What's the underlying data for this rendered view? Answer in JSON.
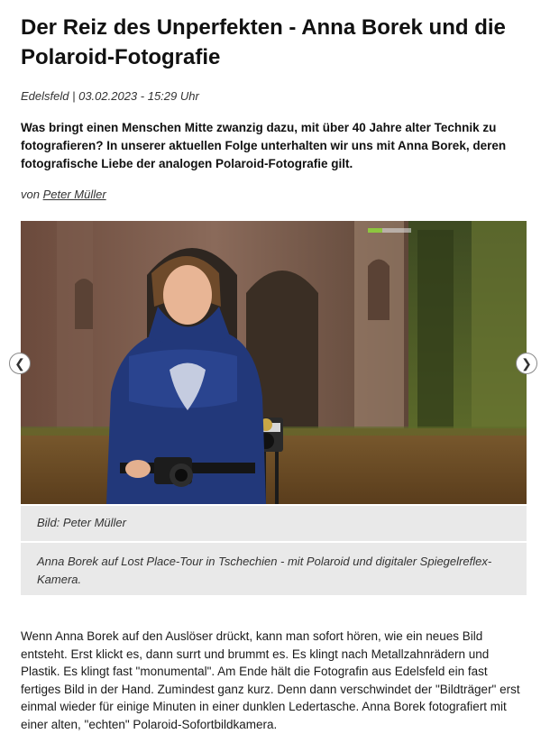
{
  "article": {
    "title": "Der Reiz des Unperfekten - Anna Borek und die Polaroid-Fotografie",
    "location": "Edelsfeld",
    "separator": " | ",
    "datetime": "03.02.2023 - 15:29 Uhr",
    "lead": "Was bringt einen Menschen Mitte zwanzig dazu, mit über 40 Jahre alter Technik zu fotografieren? In unserer aktuellen Folge unterhalten wir uns mit Anna Borek, deren fotografische Liebe der analogen Polaroid-Fotografie gilt.",
    "author_prefix": "von ",
    "author_name": "Peter Müller"
  },
  "gallery": {
    "image_description": "Frau mit Kameras vor einer Kirchenruine",
    "credit": "Bild: Peter Müller",
    "caption": "Anna Borek auf Lost Place-Tour in Tschechien - mit Polaroid und digitaler Spiegelreflex-Kamera.",
    "prev_icon": "chevron-left-icon",
    "next_icon": "chevron-right-icon",
    "active_color": "#8dc63f"
  },
  "body": {
    "paragraph1": "Wenn Anna Borek auf den Auslöser drückt, kann man sofort hören, wie ein neues Bild entsteht. Erst klickt es, dann surrt und brummt es. Es klingt nach Metallzahnrädern und Plastik. Es klingt fast \"monumental\". Am Ende hält die Fotografin aus Edelsfeld ein fast fertiges Bild in der Hand. Zumindest ganz kurz. Denn dann verschwindet der \"Bildträger\" erst einmal wieder für einige Minuten in einer dunklen Ledertasche. Anna Borek fotografiert mit einer alten, \"echten\" Polaroid-Sofortbildkamera."
  }
}
